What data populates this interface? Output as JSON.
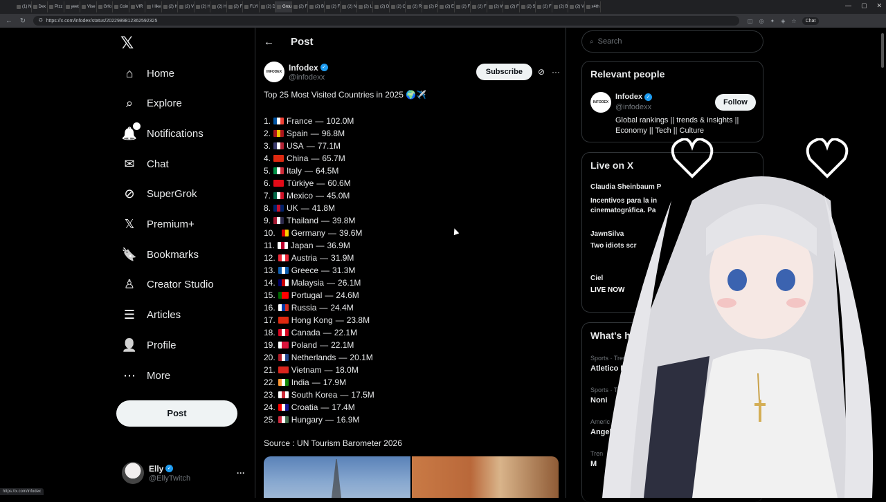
{
  "browser": {
    "tabs": [
      "(1) N",
      "Dex",
      "Pizz",
      "yeet",
      "Vise",
      "Grfo",
      "Coin",
      "VIR",
      "I like",
      "(2) H",
      "(2) V",
      "(2) H",
      "(2) H",
      "(2) F",
      "FLYI",
      "(2) D",
      "Grou",
      "(2) F",
      "(2) B",
      "(2) F",
      "(2) N",
      "(2) L",
      "(2) D",
      "(2) C",
      "(2) R",
      "(2) P",
      "(2) E",
      "(2) F",
      "(2) F",
      "(2) W",
      "(2) F",
      "(2) S",
      "(2) F",
      "(2) B",
      "(2) V",
      "x4th"
    ],
    "url": "https://x.com/infodex/status/2022989812362592325",
    "chat_label": "Chat",
    "status_url": "https://x.com/infodex"
  },
  "sidebar": {
    "items": [
      {
        "label": "Home",
        "icon": "home-icon"
      },
      {
        "label": "Explore",
        "icon": "search-icon"
      },
      {
        "label": "Notifications",
        "icon": "bell-icon",
        "badge": "2"
      },
      {
        "label": "Chat",
        "icon": "mail-icon"
      },
      {
        "label": "SuperGrok",
        "icon": "grok-icon"
      },
      {
        "label": "Premium+",
        "icon": "x-icon"
      },
      {
        "label": "Bookmarks",
        "icon": "bookmark-icon"
      },
      {
        "label": "Creator Studio",
        "icon": "creator-icon"
      },
      {
        "label": "Articles",
        "icon": "articles-icon"
      },
      {
        "label": "Profile",
        "icon": "person-icon"
      },
      {
        "label": "More",
        "icon": "more-circle-icon"
      }
    ],
    "post_button": "Post",
    "account": {
      "name": "Elly",
      "handle": "@EllyTwitch"
    }
  },
  "main": {
    "header_title": "Post",
    "author": {
      "name": "Infodex",
      "handle": "@infodexx",
      "avatar_text": "INFODEX"
    },
    "subscribe_label": "Subscribe",
    "post_title": "Top 25 Most Visited Countries in 2025 🌍✈️",
    "rankings": [
      {
        "rank": "1.",
        "country": "France",
        "value": "102.0M",
        "flag": [
          "#0055a4",
          "#ffffff",
          "#ef4135"
        ]
      },
      {
        "rank": "2.",
        "country": "Spain",
        "value": "96.8M",
        "flag": [
          "#aa151b",
          "#f1bf00",
          "#aa151b"
        ]
      },
      {
        "rank": "3.",
        "country": "USA",
        "value": "77.1M",
        "flag": [
          "#3c3b6e",
          "#ffffff",
          "#b22234"
        ]
      },
      {
        "rank": "4.",
        "country": "China",
        "value": "65.7M",
        "flag": [
          "#de2910",
          "#de2910",
          "#de2910"
        ]
      },
      {
        "rank": "5.",
        "country": "Italy",
        "value": "64.5M",
        "flag": [
          "#009246",
          "#ffffff",
          "#ce2b37"
        ]
      },
      {
        "rank": "6.",
        "country": "Türkiye",
        "value": "60.6M",
        "flag": [
          "#e30a17",
          "#e30a17",
          "#e30a17"
        ]
      },
      {
        "rank": "7.",
        "country": "Mexico",
        "value": "45.0M",
        "flag": [
          "#006847",
          "#ffffff",
          "#ce1126"
        ]
      },
      {
        "rank": "8.",
        "country": "UK",
        "value": "41.8M",
        "flag": [
          "#012169",
          "#c8102e",
          "#012169"
        ]
      },
      {
        "rank": "9.",
        "country": "Thailand",
        "value": "39.8M",
        "flag": [
          "#a51931",
          "#f4f5f8",
          "#2d2a4a"
        ]
      },
      {
        "rank": "10.",
        "country": "Germany",
        "value": "39.6M",
        "flag": [
          "#000000",
          "#dd0000",
          "#ffce00"
        ]
      },
      {
        "rank": "11.",
        "country": "Japan",
        "value": "36.9M",
        "flag": [
          "#ffffff",
          "#bc002d",
          "#ffffff"
        ]
      },
      {
        "rank": "12.",
        "country": "Austria",
        "value": "31.9M",
        "flag": [
          "#ed2939",
          "#ffffff",
          "#ed2939"
        ]
      },
      {
        "rank": "13.",
        "country": "Greece",
        "value": "31.3M",
        "flag": [
          "#0d5eaf",
          "#ffffff",
          "#0d5eaf"
        ]
      },
      {
        "rank": "14.",
        "country": "Malaysia",
        "value": "26.1M",
        "flag": [
          "#010066",
          "#cc0001",
          "#ffffff"
        ]
      },
      {
        "rank": "15.",
        "country": "Portugal",
        "value": "24.6M",
        "flag": [
          "#006600",
          "#ff0000",
          "#ff0000"
        ]
      },
      {
        "rank": "16.",
        "country": "Russia",
        "value": "24.4M",
        "flag": [
          "#ffffff",
          "#0039a6",
          "#d52b1e"
        ]
      },
      {
        "rank": "17.",
        "country": "Hong Kong",
        "value": "23.8M",
        "flag": [
          "#de2910",
          "#de2910",
          "#de2910"
        ]
      },
      {
        "rank": "18.",
        "country": "Canada",
        "value": "22.1M",
        "flag": [
          "#d80621",
          "#ffffff",
          "#d80621"
        ]
      },
      {
        "rank": "19.",
        "country": "Poland",
        "value": "22.1M",
        "flag": [
          "#ffffff",
          "#dc143c",
          "#dc143c"
        ]
      },
      {
        "rank": "20.",
        "country": "Netherlands",
        "value": "20.1M",
        "flag": [
          "#ae1c28",
          "#ffffff",
          "#21468b"
        ]
      },
      {
        "rank": "21.",
        "country": "Vietnam",
        "value": "18.0M",
        "flag": [
          "#da251d",
          "#da251d",
          "#da251d"
        ]
      },
      {
        "rank": "22.",
        "country": "India",
        "value": "17.9M",
        "flag": [
          "#ff9933",
          "#ffffff",
          "#138808"
        ]
      },
      {
        "rank": "23.",
        "country": "South Korea",
        "value": "17.5M",
        "flag": [
          "#ffffff",
          "#cd2e3a",
          "#ffffff"
        ]
      },
      {
        "rank": "24.",
        "country": "Croatia",
        "value": "17.4M",
        "flag": [
          "#ff0000",
          "#ffffff",
          "#171796"
        ]
      },
      {
        "rank": "25.",
        "country": "Hungary",
        "value": "16.9M",
        "flag": [
          "#cd2a3e",
          "#ffffff",
          "#436f4d"
        ]
      }
    ],
    "separator": "—",
    "source": "Source : UN Tourism Barometer 2026"
  },
  "right": {
    "search_placeholder": "Search",
    "relevant_title": "Relevant people",
    "relevant": {
      "name": "Infodex",
      "handle": "@infodexx",
      "bio": "Global rankings || trends & insights || Economy || Tech || Culture",
      "follow_label": "Follow",
      "avatar_text": "INFODEX"
    },
    "live_title": "Live on X",
    "live_items": [
      {
        "user": "Claudia Sheinbaum P",
        "text": "Incentivos para la in\ncinematográfica. Pa"
      },
      {
        "user": "JawnSilva",
        "text": "Two idiots scr"
      },
      {
        "user": "Ciel",
        "text": "LIVE NOW"
      }
    ],
    "happening_title": "What's ha",
    "trends": [
      {
        "category": "Sports · Trend",
        "name": "Atletico M"
      },
      {
        "category": "Sports · Trend",
        "name": "Noni"
      },
      {
        "category": "Americ",
        "name": "Angeli"
      },
      {
        "category": "Tren",
        "name": "M"
      }
    ]
  },
  "colors": {
    "accent": "#1d9bf0",
    "background": "#000000",
    "border": "#2f3336"
  }
}
